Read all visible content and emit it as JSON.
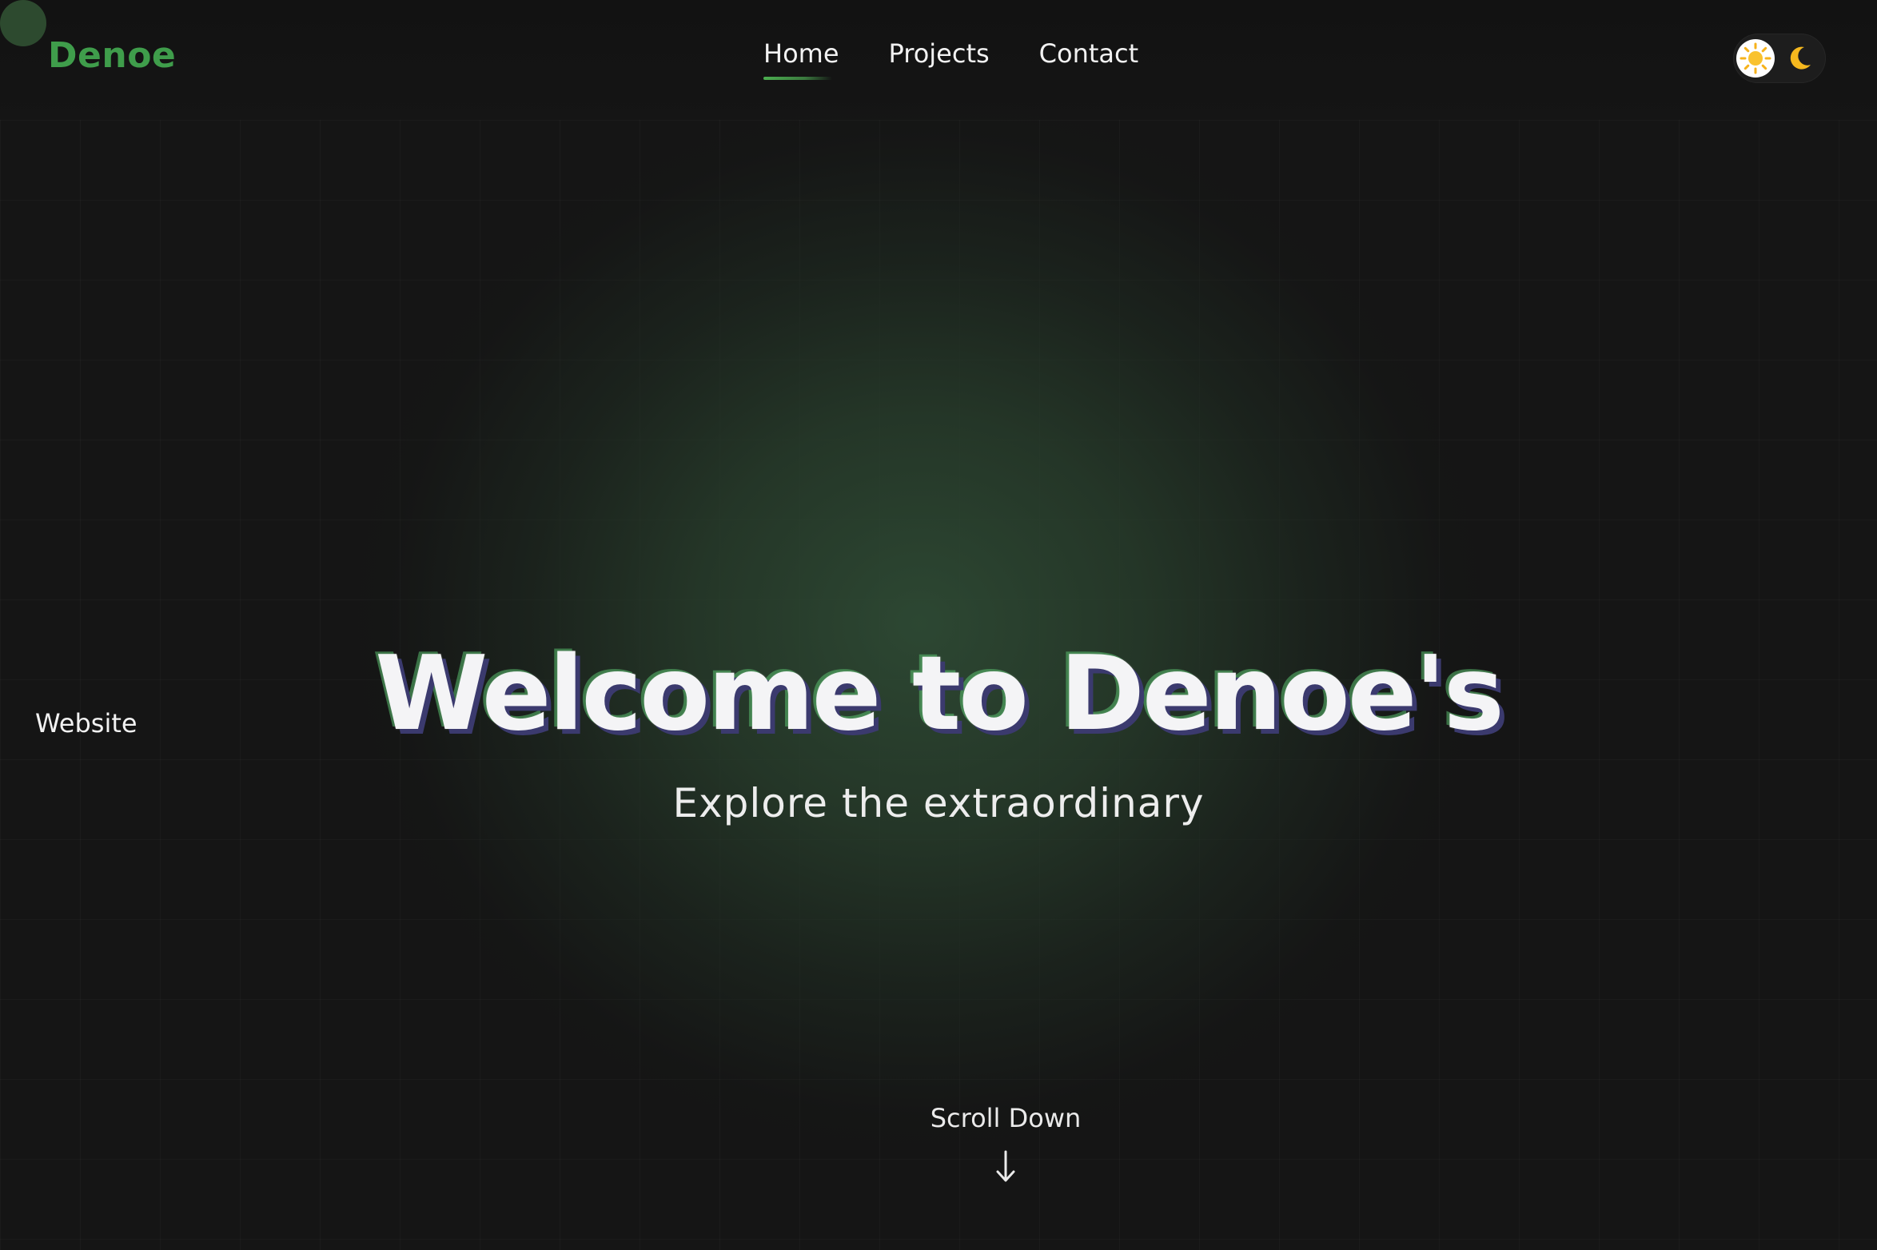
{
  "header": {
    "logo": "Denoe",
    "nav": [
      {
        "label": "Home",
        "active": true
      },
      {
        "label": "Projects",
        "active": false
      },
      {
        "label": "Contact",
        "active": false
      }
    ],
    "theme_toggle": {
      "icons": [
        "sun-icon",
        "moon-icon"
      ],
      "selected": "light"
    }
  },
  "hero": {
    "title": "Welcome to Denoe's",
    "side_label": "Website",
    "subtitle": "Explore the extraordinary",
    "scroll_label": "Scroll Down",
    "scroll_icon": "arrow-down-icon"
  },
  "colors": {
    "background": "#151515",
    "accent": "#3f9d4b",
    "glow": "#2e4a34",
    "title_shadow": "#3b3a6e"
  }
}
